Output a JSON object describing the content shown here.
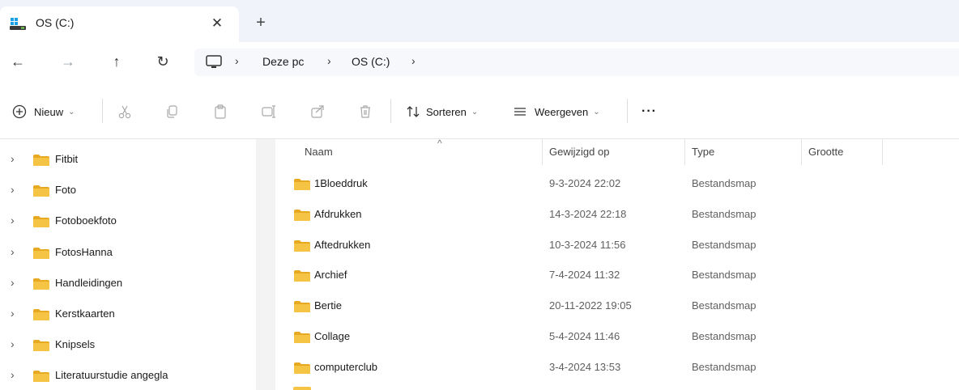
{
  "tab": {
    "title": "OS (C:)",
    "close_glyph": "✕",
    "new_tab_glyph": "+"
  },
  "nav": {
    "back_glyph": "←",
    "forward_glyph": "→",
    "up_glyph": "↑",
    "refresh_glyph": "↻"
  },
  "address": {
    "sep_glyph": "›",
    "crumbs": [
      "Deze pc",
      "OS (C:)"
    ]
  },
  "toolbar": {
    "new_label": "Nieuw",
    "sort_label": "Sorteren",
    "view_label": "Weergeven",
    "more_label": "···",
    "chevron": "⌄"
  },
  "tree": [
    {
      "label": "Fitbit"
    },
    {
      "label": "Foto"
    },
    {
      "label": "Fotoboekfoto"
    },
    {
      "label": "FotosHanna"
    },
    {
      "label": "Handleidingen"
    },
    {
      "label": "Kerstkaarten"
    },
    {
      "label": "Knipsels"
    },
    {
      "label": "Literatuurstudie angegla"
    }
  ],
  "tree_chevron": "›",
  "columns": {
    "name": "Naam",
    "modified": "Gewijzigd op",
    "type": "Type",
    "size": "Grootte",
    "sort_glyph": "^"
  },
  "files": [
    {
      "name": "1Bloeddruk",
      "modified": "9-3-2024 22:02",
      "type": "Bestandsmap",
      "size": ""
    },
    {
      "name": "Afdrukken",
      "modified": "14-3-2024 22:18",
      "type": "Bestandsmap",
      "size": ""
    },
    {
      "name": "Aftedrukken",
      "modified": "10-3-2024 11:56",
      "type": "Bestandsmap",
      "size": ""
    },
    {
      "name": "Archief",
      "modified": "7-4-2024 11:32",
      "type": "Bestandsmap",
      "size": ""
    },
    {
      "name": "Bertie",
      "modified": "20-11-2022 19:05",
      "type": "Bestandsmap",
      "size": ""
    },
    {
      "name": "Collage",
      "modified": "5-4-2024 11:46",
      "type": "Bestandsmap",
      "size": ""
    },
    {
      "name": "computerclub",
      "modified": "3-4-2024 13:53",
      "type": "Bestandsmap",
      "size": ""
    }
  ],
  "colors": {
    "folder": "#f5c445",
    "folder_dark": "#e8a922",
    "tabstrip": "#f0f3f9"
  },
  "icons": {
    "drive": "drive-icon",
    "pc": "pc-icon",
    "folder": "folder-icon",
    "new": "plus-circle-icon",
    "cut": "scissors-icon",
    "copy": "copy-icon",
    "paste": "paste-icon",
    "rename": "rename-icon",
    "share": "share-icon",
    "delete": "trash-icon",
    "sort": "sort-icon",
    "view": "view-lines-icon"
  }
}
